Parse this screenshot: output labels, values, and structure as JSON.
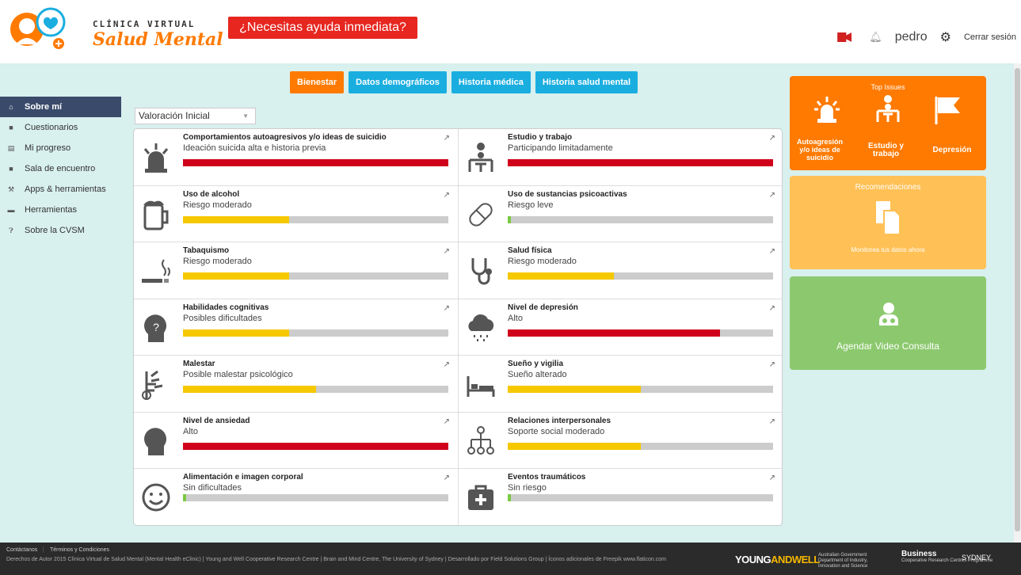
{
  "header": {
    "brand_top": "CLÍNICA VIRTUAL",
    "brand_bottom": "Salud Mental",
    "help_button": "¿Necesitas ayuda inmediata?",
    "username": "pedro",
    "logout": "Cerrar sesión"
  },
  "sidebar": {
    "items": [
      {
        "label": "Sobre mí",
        "icon": "home-icon"
      },
      {
        "label": "Cuestionarios",
        "icon": "square-icon"
      },
      {
        "label": "Mi progreso",
        "icon": "chart-icon"
      },
      {
        "label": "Sala de encuentro",
        "icon": "video-icon"
      },
      {
        "label": "Apps & herramientas",
        "icon": "wrench-icon"
      },
      {
        "label": "Herramientas",
        "icon": "folder-icon"
      },
      {
        "label": "Sobre la CVSM",
        "icon": "question-icon"
      }
    ]
  },
  "tabs": [
    "Bienestar",
    "Datos demográficos",
    "Historia médica",
    "Historia salud mental"
  ],
  "select": {
    "value": "Valoración Inicial"
  },
  "colors": {
    "orange": "#ff7a00",
    "blue": "#1aaee0",
    "red": "#d0021b",
    "yellow": "#f5c800",
    "green": "#7ac943"
  },
  "cards": [
    {
      "title": "Comportamientos autoagresivos y/o ideas de suicidio",
      "sub": "Ideación suicida alta e historia previa",
      "level": 1.0,
      "color": "#d0021b",
      "icon": "alarm-icon"
    },
    {
      "title": "Estudio y trabajo",
      "sub": "Participando limitadamente",
      "level": 1.0,
      "color": "#d0021b",
      "icon": "desk-icon"
    },
    {
      "title": "Uso de alcohol",
      "sub": "Riesgo moderado",
      "level": 0.4,
      "color": "#f5c800",
      "icon": "beer-icon"
    },
    {
      "title": "Uso de sustancias psicoactivas",
      "sub": "Riesgo leve",
      "level": 0.01,
      "color": "#7ac943",
      "icon": "pill-icon"
    },
    {
      "title": "Tabaquismo",
      "sub": "Riesgo moderado",
      "level": 0.4,
      "color": "#f5c800",
      "icon": "cigarette-icon"
    },
    {
      "title": "Salud física",
      "sub": "Riesgo moderado",
      "level": 0.4,
      "color": "#f5c800",
      "icon": "stethoscope-icon"
    },
    {
      "title": "Habilidades cognitivas",
      "sub": "Posibles dificultades",
      "level": 0.4,
      "color": "#f5c800",
      "icon": "head-question-icon"
    },
    {
      "title": "Nivel de depresión",
      "sub": "Alto",
      "level": 0.8,
      "color": "#d0021b",
      "icon": "rain-cloud-icon"
    },
    {
      "title": "Malestar",
      "sub": "Posible malestar psicológico",
      "level": 0.5,
      "color": "#f5c800",
      "icon": "stress-icon"
    },
    {
      "title": "Sueño y vigilia",
      "sub": "Sueño alterado",
      "level": 0.5,
      "color": "#f5c800",
      "icon": "bed-icon"
    },
    {
      "title": "Nivel de ansiedad",
      "sub": "Alto",
      "level": 1.0,
      "color": "#d0021b",
      "icon": "head-icon"
    },
    {
      "title": "Relaciones interpersonales",
      "sub": "Soporte social moderado",
      "level": 0.5,
      "color": "#f5c800",
      "icon": "network-icon"
    },
    {
      "title": "Alimentación e imagen corporal",
      "sub": "Sin dificultades",
      "level": 0.01,
      "color": "#7ac943",
      "icon": "smile-icon"
    },
    {
      "title": "Eventos traumáticos",
      "sub": "Sin riesgo",
      "level": 0.01,
      "color": "#7ac943",
      "icon": "first-aid-icon"
    }
  ],
  "top_issues": {
    "title": "Top Issues",
    "items": [
      "Autoagresión y/o ideas de suicidio",
      "Estudio y trabajo",
      "Depresión"
    ]
  },
  "recomendaciones": {
    "title": "Recomendaciones",
    "body": "Monitorea tus datos ahora"
  },
  "agenda": {
    "label": "Agendar Video Consulta"
  },
  "footer": {
    "links": [
      "Contáctanos",
      "Términos y Condiciones"
    ],
    "copyright": "Derechos de Autor 2015 Clínica Virtual de Salud Mental (Mental Health eClinic) | Young and Well Cooperative Research Centre | Brain and Mind Centre, The University of Sydney | Desarrollado por Field Solutions Group | Íconos adicionales de Freepik www.flaticon.com",
    "partner1a": "YOUNG",
    "partner1b": "ANDWELL",
    "partner2": "Australian Government Department of Industry, Innovation and Science",
    "partner3a": "Business",
    "partner3b": "Cooperative Research Centres Programme",
    "partner4": "SYDNEY"
  }
}
